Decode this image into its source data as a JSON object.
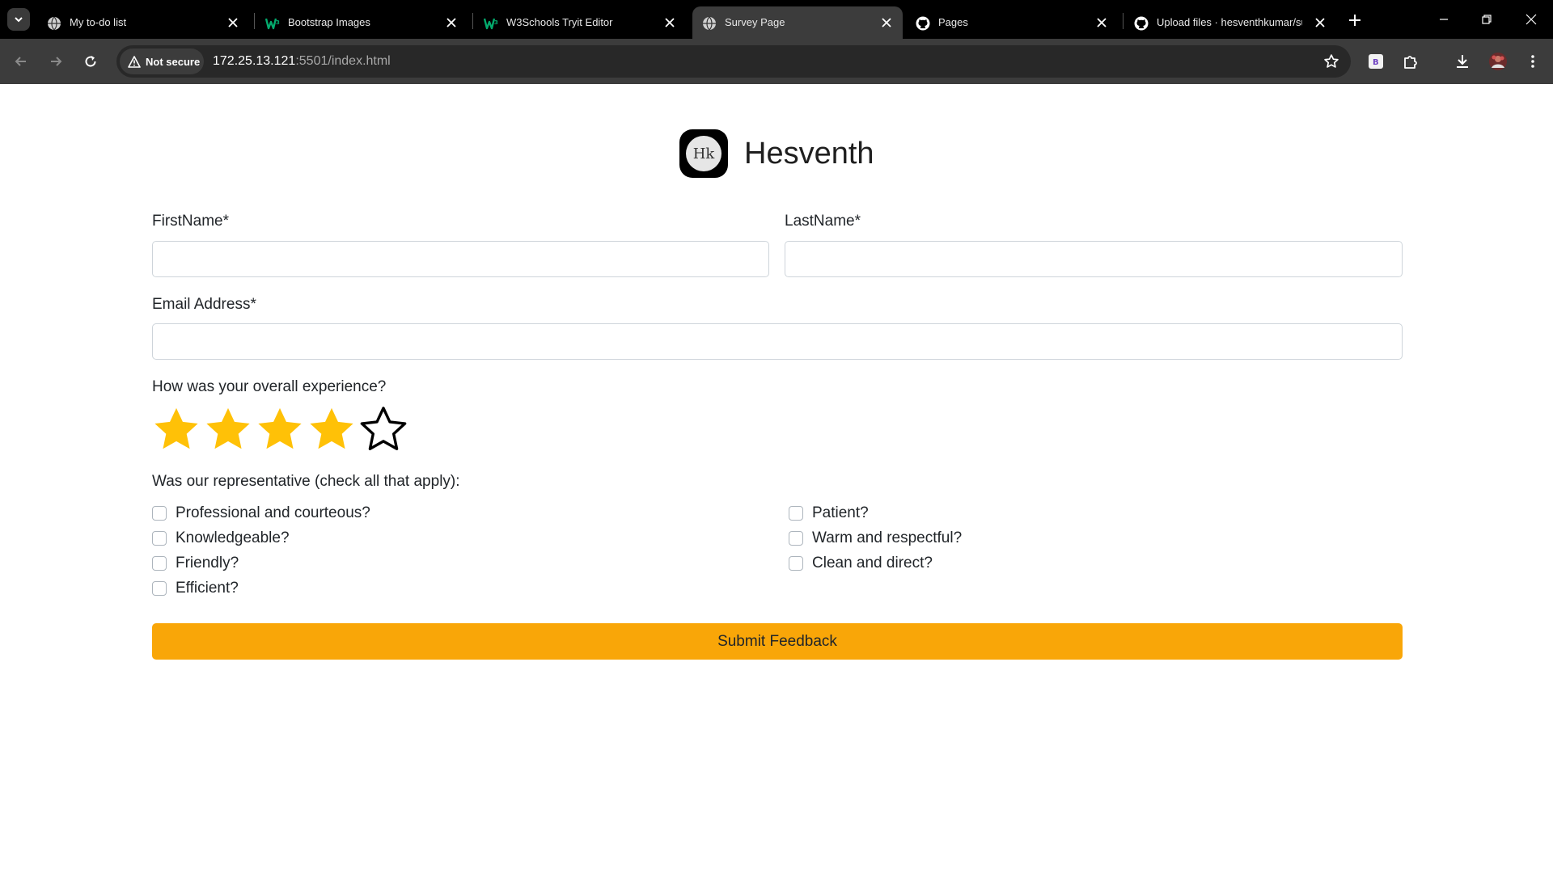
{
  "browser": {
    "tabs": [
      {
        "title": "My to-do list",
        "icon": "globe-icon",
        "active": false
      },
      {
        "title": "Bootstrap Images",
        "icon": "w3schools-icon",
        "active": false
      },
      {
        "title": "W3Schools Tryit Editor",
        "icon": "w3schools-icon",
        "active": false
      },
      {
        "title": "Survey Page",
        "icon": "globe-icon",
        "active": true
      },
      {
        "title": "Pages",
        "icon": "github-icon",
        "active": false
      },
      {
        "title": "Upload files · hesventhkumar/su",
        "icon": "github-icon",
        "active": false
      }
    ],
    "security_label": "Not secure",
    "url_host": "172.25.13.121",
    "url_rest": ":5501/index.html",
    "colors": {
      "tabstrip": "#000000",
      "toolbar": "#3c3c3c",
      "omnibox": "#282828"
    }
  },
  "page": {
    "brand": {
      "logo_text": "Hk",
      "name": "Hesventh"
    },
    "form": {
      "first_name": {
        "label": "FirstName*",
        "value": ""
      },
      "last_name": {
        "label": "LastName*",
        "value": ""
      },
      "email": {
        "label": "Email Address*",
        "value": ""
      },
      "rating": {
        "question": "How was your overall experience?",
        "value": 4,
        "max": 5,
        "color": "#ffc107"
      },
      "representative": {
        "question": "Was our representative (check all that apply):",
        "options_left": [
          "Professional and courteous?",
          "Knowledgeable?",
          "Friendly?",
          "Efficient?"
        ],
        "options_right": [
          "Patient?",
          "Warm and respectful?",
          "Clean and direct?"
        ]
      },
      "submit_label": "Submit Feedback",
      "submit_color": "#f9a608"
    }
  }
}
